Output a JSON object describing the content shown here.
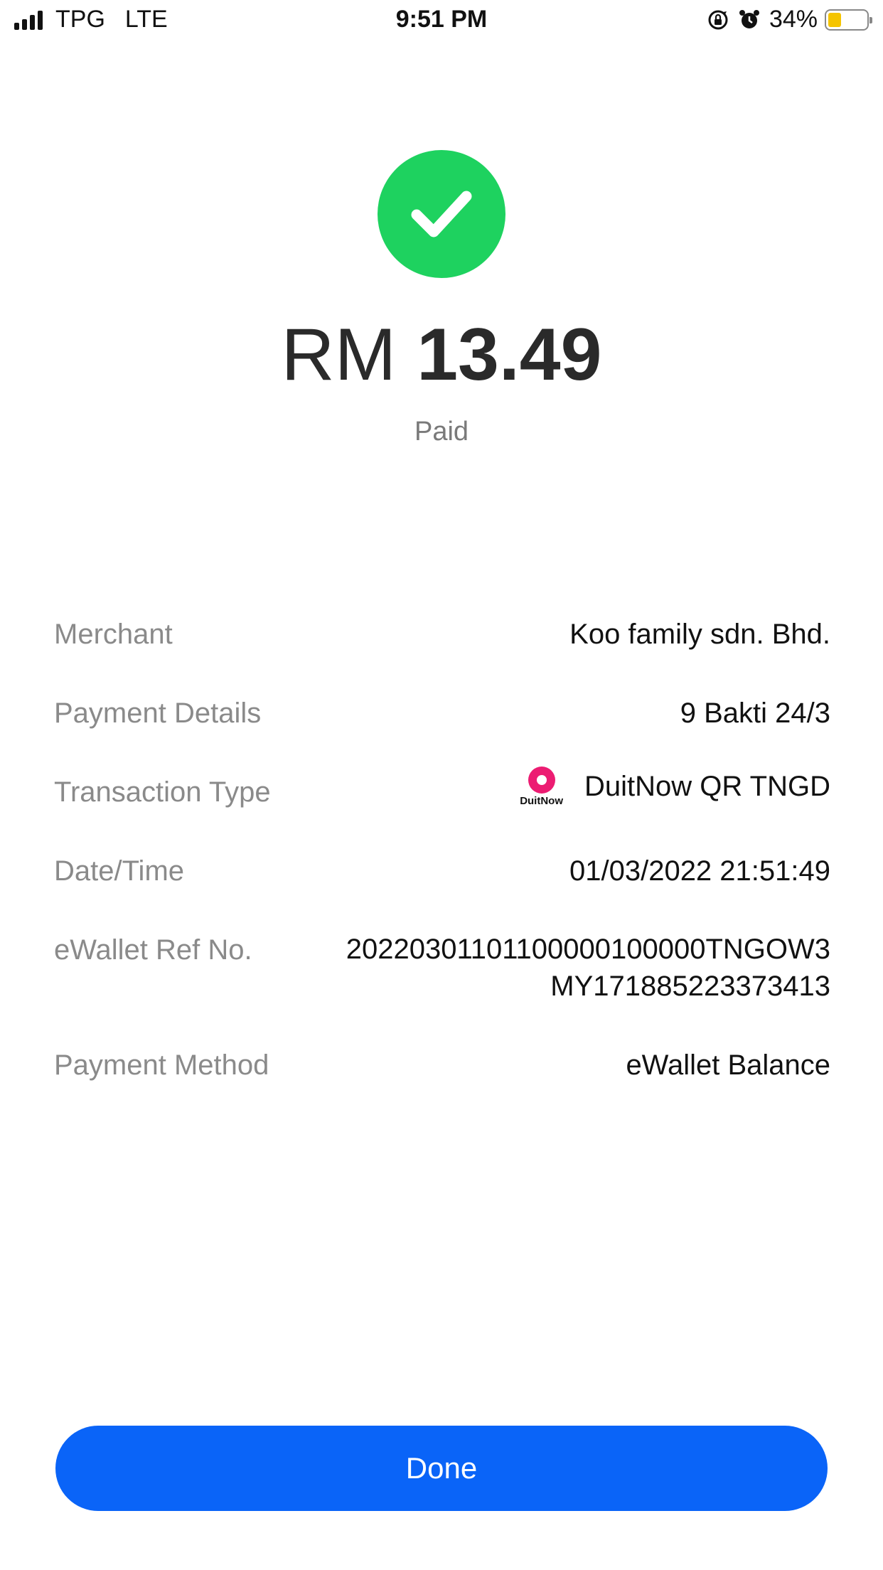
{
  "status_bar": {
    "carrier": "TPG",
    "network": "LTE",
    "time": "9:51 PM",
    "battery_percent": "34%",
    "battery_level": 0.34,
    "battery_color": "#f5c400"
  },
  "receipt": {
    "currency": "RM",
    "amount": "13.49",
    "status": "Paid",
    "status_icon": "check-icon",
    "success_color": "#1ed25f"
  },
  "details": {
    "merchant": {
      "label": "Merchant",
      "value": "Koo family sdn. Bhd."
    },
    "payment_details": {
      "label": "Payment Details",
      "value": "9 Bakti 24/3"
    },
    "transaction_type": {
      "label": "Transaction Type",
      "logo_text": "DuitNow",
      "value": "DuitNow QR TNGD"
    },
    "date_time": {
      "label": "Date/Time",
      "value": "01/03/2022 21:51:49"
    },
    "ewallet_ref": {
      "label": "eWallet Ref No.",
      "value_line1": "20220301101100000100000TNGOW3",
      "value_line2": "MY171885223373413"
    },
    "payment_method": {
      "label": "Payment Method",
      "value": "eWallet Balance"
    }
  },
  "actions": {
    "done_label": "Done",
    "accent_color": "#0a64f8"
  }
}
